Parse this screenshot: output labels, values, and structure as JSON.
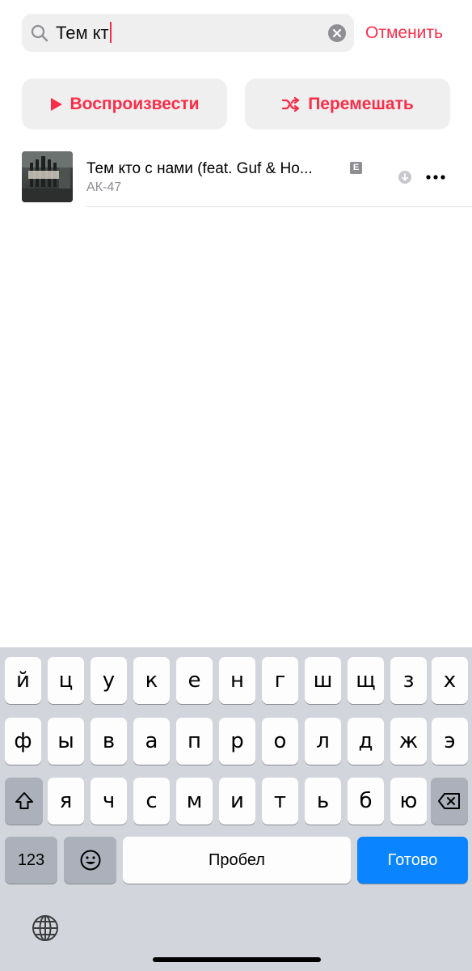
{
  "search": {
    "query": "Тем кт",
    "cancel_label": "Отменить"
  },
  "actions": {
    "play_label": "Воспроизвести",
    "shuffle_label": "Перемешать"
  },
  "song": {
    "title": "Тем кто с нами (feat. Guf & Но...",
    "explicit_badge": "E",
    "artist": "АК-47"
  },
  "keyboard": {
    "row1": [
      "й",
      "ц",
      "у",
      "к",
      "е",
      "н",
      "г",
      "ш",
      "щ",
      "з",
      "х"
    ],
    "row2": [
      "ф",
      "ы",
      "в",
      "а",
      "п",
      "р",
      "о",
      "л",
      "д",
      "ж",
      "э"
    ],
    "row3": [
      "я",
      "ч",
      "с",
      "м",
      "и",
      "т",
      "ь",
      "б",
      "ю"
    ],
    "numbers_label": "123",
    "space_label": "Пробел",
    "done_label": "Готово"
  },
  "colors": {
    "accent": "#fa2d48",
    "done_blue": "#0a84ff",
    "keyboard_bg": "#d2d5db"
  }
}
